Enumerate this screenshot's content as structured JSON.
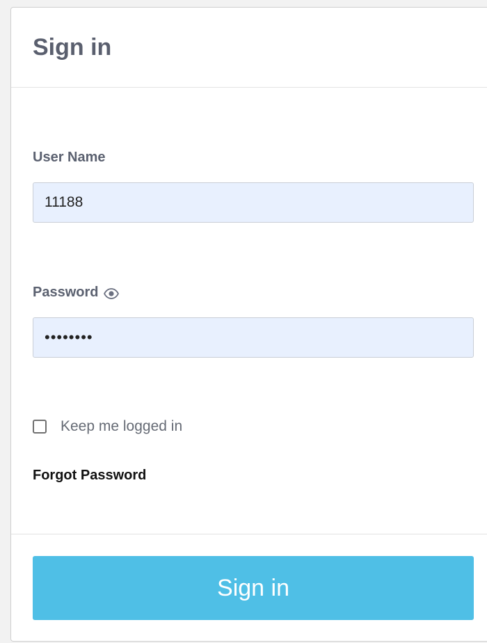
{
  "header": {
    "title": "Sign in"
  },
  "username": {
    "label": "User Name",
    "value": "11188"
  },
  "password": {
    "label": "Password",
    "value": "********",
    "toggle_icon": "eye-icon"
  },
  "remember": {
    "label": "Keep me logged in",
    "checked": false
  },
  "forgot": {
    "label": "Forgot Password"
  },
  "footer": {
    "submit_label": "Sign in"
  },
  "colors": {
    "accent": "#4fbfe6",
    "input_bg": "#e8f0fe",
    "title": "#5a5f6e"
  }
}
